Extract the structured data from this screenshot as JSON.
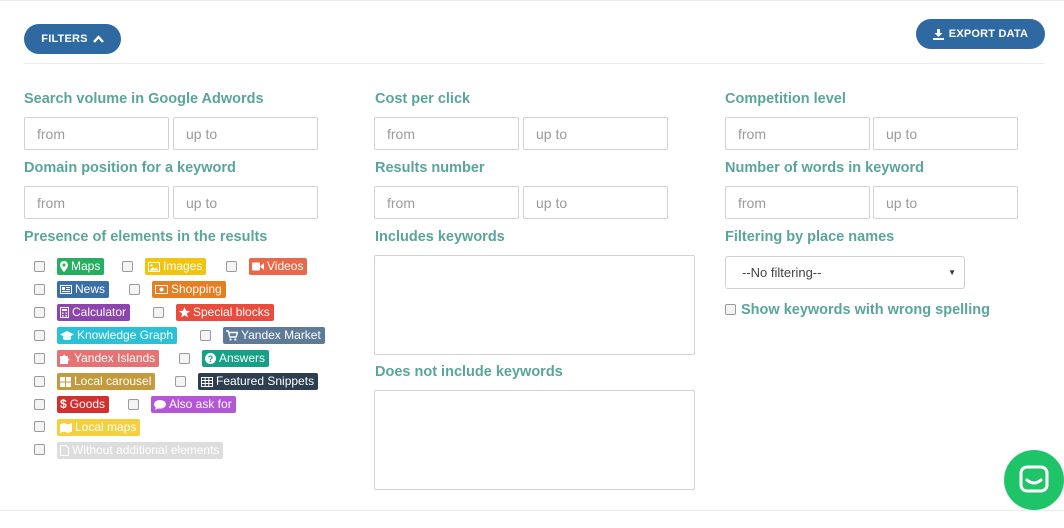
{
  "toolbar": {
    "filters_label": "FILTERS",
    "export_label": "EXPORT DATA"
  },
  "fields": {
    "search_volume": {
      "label": "Search volume in Google Adwords",
      "from_placeholder": "from",
      "to_placeholder": "up to"
    },
    "cost_per_click": {
      "label": "Cost per click",
      "from_placeholder": "from",
      "to_placeholder": "up to"
    },
    "competition_level": {
      "label": "Competition level",
      "from_placeholder": "from",
      "to_placeholder": "up to"
    },
    "domain_position": {
      "label": "Domain position for a keyword",
      "from_placeholder": "from",
      "to_placeholder": "up to"
    },
    "results_number": {
      "label": "Results number",
      "from_placeholder": "from",
      "to_placeholder": "up to"
    },
    "words_number": {
      "label": "Number of words in keyword",
      "from_placeholder": "from",
      "to_placeholder": "up to"
    }
  },
  "presence": {
    "label": "Presence of elements in the results",
    "items": [
      {
        "label": "Maps",
        "icon": "map-marker-icon",
        "color": "#27ae60"
      },
      {
        "label": "Images",
        "icon": "image-icon",
        "color": "#f1c40f"
      },
      {
        "label": "Videos",
        "icon": "video-camera-icon",
        "color": "#e8694a"
      },
      {
        "label": "News",
        "icon": "newspaper-icon",
        "color": "#3a6fa8"
      },
      {
        "label": "Shopping",
        "icon": "money-icon",
        "color": "#e67e22"
      },
      {
        "label": "Calculator",
        "icon": "calculator-icon",
        "color": "#8e44ad"
      },
      {
        "label": "Special blocks",
        "icon": "star-icon",
        "color": "#e74c3c"
      },
      {
        "label": "Knowledge Graph",
        "icon": "graduation-cap-icon",
        "color": "#2bc0d6"
      },
      {
        "label": "Yandex Market",
        "icon": "cart-icon",
        "color": "#5d7a99"
      },
      {
        "label": "Yandex Islands",
        "icon": "puzzle-icon",
        "color": "#e57373"
      },
      {
        "label": "Answers",
        "icon": "question-icon",
        "color": "#16a085"
      },
      {
        "label": "Local carousel",
        "icon": "grid-icon",
        "color": "#c39a3d"
      },
      {
        "label": "Featured Snippets",
        "icon": "table-icon",
        "color": "#2c3e50"
      },
      {
        "label": "Goods",
        "icon": "dollar-icon",
        "color": "#d32f2f"
      },
      {
        "label": "Also ask for",
        "icon": "comment-icon",
        "color": "#b556d8"
      },
      {
        "label": "Local maps",
        "icon": "folded-map-icon",
        "color": "#f4d03f"
      },
      {
        "label": "Without additional elements",
        "icon": "file-icon",
        "color": "#dddddd"
      }
    ]
  },
  "keywords": {
    "includes_label": "Includes keywords",
    "excludes_label": "Does not include keywords"
  },
  "place_filter": {
    "label": "Filtering by place names",
    "selected": "--No filtering--"
  },
  "spelling": {
    "label": "Show keywords with wrong spelling"
  },
  "chat": {
    "icon": "chat-icon",
    "color": "#1fc468"
  }
}
